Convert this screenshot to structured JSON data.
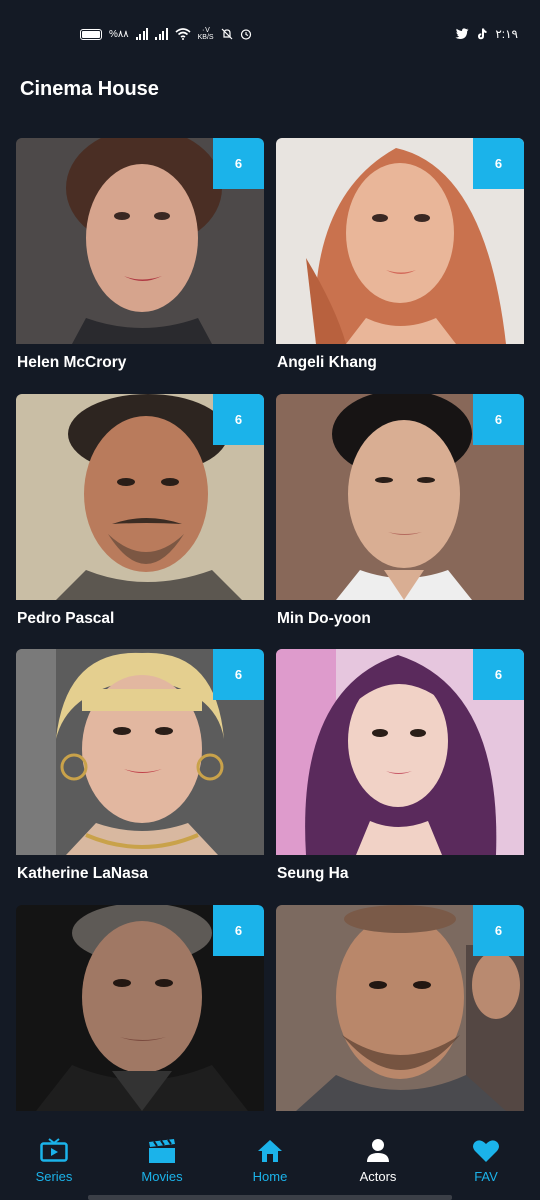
{
  "status_bar": {
    "left_text": "%۸۸",
    "speed_top": "۰V",
    "speed_bottom": "KB/S",
    "time": "۲:۱۹"
  },
  "app": {
    "title": "Cinema House"
  },
  "colors": {
    "accent": "#1bb3ea",
    "background": "#141a25"
  },
  "actors": [
    {
      "name": "Helen McCrory",
      "badge": "6"
    },
    {
      "name": "Angeli Khang",
      "badge": "6"
    },
    {
      "name": "Pedro Pascal",
      "badge": "6"
    },
    {
      "name": "Min Do-yoon",
      "badge": "6"
    },
    {
      "name": "Katherine LaNasa",
      "badge": "6"
    },
    {
      "name": "Seung Ha",
      "badge": "6"
    },
    {
      "name": "",
      "badge": "6"
    },
    {
      "name": "",
      "badge": "6"
    }
  ],
  "nav": {
    "items": [
      {
        "label": "Series",
        "icon": "tv-icon"
      },
      {
        "label": "Movies",
        "icon": "clapperboard-icon"
      },
      {
        "label": "Home",
        "icon": "home-icon"
      },
      {
        "label": "Actors",
        "icon": "person-icon",
        "active": true
      },
      {
        "label": "FAV",
        "icon": "heart-icon"
      }
    ]
  }
}
